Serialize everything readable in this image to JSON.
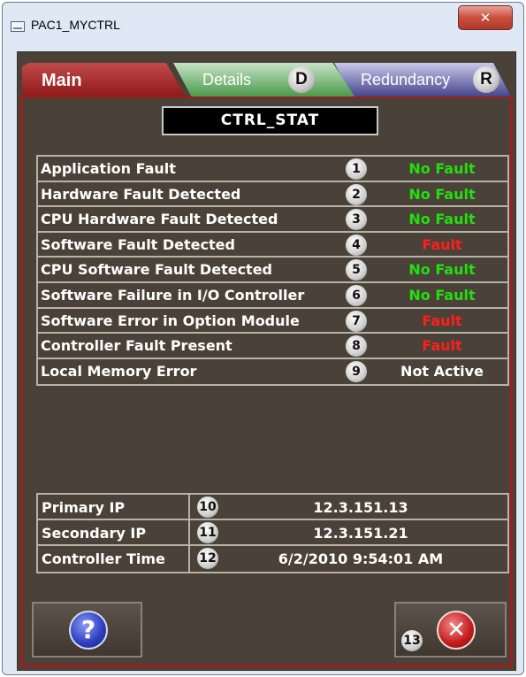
{
  "window": {
    "title": "PAC1_MYCTRL",
    "close_glyph": "✕"
  },
  "tabs": [
    {
      "label": "Main",
      "active": true,
      "color": "#9a1f1f"
    },
    {
      "label": "Details",
      "shortcut": "D",
      "active": false,
      "color": "#3f8f3f"
    },
    {
      "label": "Redundancy",
      "shortcut": "R",
      "active": false,
      "color": "#40408a"
    }
  ],
  "header": {
    "title": "CTRL_STAT"
  },
  "status_rows": [
    {
      "label": "Application Fault",
      "num": "1",
      "value": "No Fault",
      "state": "nofault"
    },
    {
      "label": "Hardware Fault Detected",
      "num": "2",
      "value": "No Fault",
      "state": "nofault"
    },
    {
      "label": "CPU Hardware Fault Detected",
      "num": "3",
      "value": "No Fault",
      "state": "nofault"
    },
    {
      "label": "Software Fault Detected",
      "num": "4",
      "value": "Fault",
      "state": "fault"
    },
    {
      "label": "CPU Software Fault Detected",
      "num": "5",
      "value": "No Fault",
      "state": "nofault"
    },
    {
      "label": "Software Failure in I/O Controller",
      "num": "6",
      "value": "No Fault",
      "state": "nofault"
    },
    {
      "label": "Software Error in Option Module",
      "num": "7",
      "value": "Fault",
      "state": "fault"
    },
    {
      "label": "Controller Fault Present",
      "num": "8",
      "value": "Fault",
      "state": "fault"
    },
    {
      "label": "Local Memory Error",
      "num": "9",
      "value": "Not Active",
      "state": "notactive"
    }
  ],
  "info_rows": [
    {
      "label": "Primary IP",
      "num": "10",
      "value": "12.3.151.13"
    },
    {
      "label": "Secondary IP",
      "num": "11",
      "value": "12.3.151.21"
    },
    {
      "label": "Controller Time",
      "num": "12",
      "value": "6/2/2010 9:54:01 AM"
    }
  ],
  "buttons": {
    "help_glyph": "?",
    "exit_glyph": "✕",
    "exit_num": "13"
  },
  "colors": {
    "panel_bg": "#4a4238",
    "no_fault": "#22e010",
    "fault": "#ff1e1e",
    "active_tab": "#9a1f1f"
  }
}
